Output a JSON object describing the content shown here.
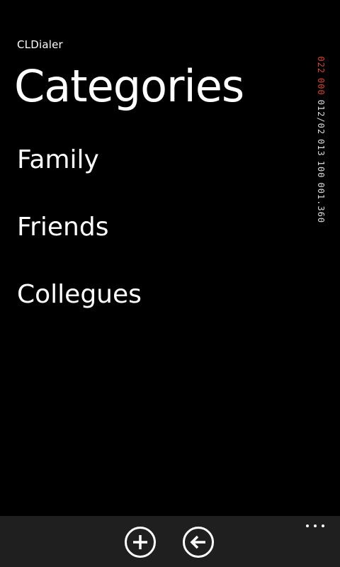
{
  "app": {
    "title": "CLDialer"
  },
  "page": {
    "title": "Categories"
  },
  "categories": [
    {
      "label": "Family"
    },
    {
      "label": "Friends"
    },
    {
      "label": "Collegues"
    }
  ],
  "frame_counter": {
    "segments": [
      {
        "text": "022",
        "color": "#d9432c"
      },
      {
        "text": "000",
        "color": "#d9432c"
      },
      {
        "text": "012/02",
        "color": "#dcdcdc"
      },
      {
        "text": "013",
        "color": "#dcdcdc"
      },
      {
        "text": "100",
        "color": "#dcdcdc"
      },
      {
        "text": "001.360",
        "color": "#dcdcdc"
      }
    ]
  },
  "app_bar": {
    "buttons": [
      {
        "icon": "add-icon"
      },
      {
        "icon": "back-arrow-icon"
      }
    ],
    "more_icon": "ellipsis-icon",
    "background": "#1f1f1f"
  }
}
